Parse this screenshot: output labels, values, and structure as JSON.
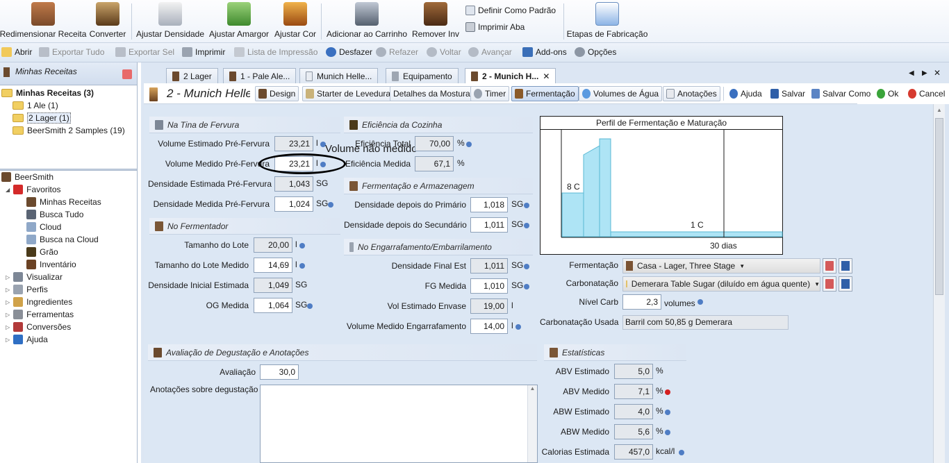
{
  "ribbon": {
    "buttons": [
      {
        "label": "Redimensionar Receita",
        "icon": "resize-recipe-icon",
        "color": "#8a5a3a"
      },
      {
        "label": "Converter",
        "icon": "convert-icon",
        "color": "#7a5a2a"
      },
      {
        "label": "Ajustar Densidade",
        "icon": "thermometer-icon",
        "color": "#b0b6c2"
      },
      {
        "label": "Ajustar Amargor",
        "icon": "hops-icon",
        "color": "#5aa042"
      },
      {
        "label": "Ajustar Cor",
        "icon": "beer-color-icon",
        "color": "#c8781e"
      },
      {
        "label": "Adicionar ao Carrinho",
        "icon": "cart-add-icon",
        "color": "#6a7686"
      },
      {
        "label": "Remover Inv",
        "icon": "inventory-remove-icon",
        "color": "#6b4224"
      },
      {
        "label": "Etapas de Fabricação",
        "icon": "brew-steps-icon",
        "color": "#5a8ed0"
      }
    ],
    "small": [
      {
        "label": "Definir Como Padrão",
        "icon": "set-default-icon"
      },
      {
        "label": "Imprimir Aba",
        "icon": "print-tab-icon"
      }
    ]
  },
  "quickbar": [
    {
      "label": "Abrir",
      "icon": "open-folder-icon",
      "enabled": true
    },
    {
      "label": "Exportar Tudo",
      "icon": "export-all-icon",
      "enabled": false
    },
    {
      "label": "Exportar Sel",
      "icon": "export-selected-icon",
      "enabled": false
    },
    {
      "label": "Imprimir",
      "icon": "print-icon",
      "enabled": true
    },
    {
      "label": "Lista de Impressão",
      "icon": "print-list-icon",
      "enabled": false
    },
    {
      "label": "Desfazer",
      "icon": "undo-icon",
      "enabled": true
    },
    {
      "label": "Refazer",
      "icon": "redo-icon",
      "enabled": false
    },
    {
      "label": "Voltar",
      "icon": "back-icon",
      "enabled": false
    },
    {
      "label": "Avançar",
      "icon": "forward-icon",
      "enabled": false
    },
    {
      "label": "Add-ons",
      "icon": "addons-icon",
      "enabled": true
    },
    {
      "label": "Opções",
      "icon": "options-gear-icon",
      "enabled": true
    }
  ],
  "recipes_panel": {
    "title": "Minhas Receitas",
    "tree": [
      {
        "label": "Minhas Receitas (3)",
        "level": 0,
        "bold": true
      },
      {
        "label": "1 Ale (1)",
        "level": 1
      },
      {
        "label": "2 Lager (1)",
        "level": 1,
        "selected": true
      },
      {
        "label": "BeerSmith 2 Samples (19)",
        "level": 1
      }
    ]
  },
  "nav_tree": [
    {
      "label": "BeerSmith",
      "level": 0,
      "icon": "beersmith-icon"
    },
    {
      "label": "Favoritos",
      "level": 1,
      "icon": "heart-icon"
    },
    {
      "label": "Minhas Receitas",
      "level": 2,
      "icon": "recipe-glass-icon"
    },
    {
      "label": "Busca Tudo",
      "level": 2,
      "icon": "search-all-icon"
    },
    {
      "label": "Cloud",
      "level": 2,
      "icon": "cloud-icon"
    },
    {
      "label": "Busca na Cloud",
      "level": 2,
      "icon": "cloud-search-icon"
    },
    {
      "label": "Grão",
      "level": 2,
      "icon": "grain-icon"
    },
    {
      "label": "Inventário",
      "level": 2,
      "icon": "inventory-icon"
    },
    {
      "label": "Visualizar",
      "level": 1,
      "icon": "view-icon"
    },
    {
      "label": "Perfis",
      "level": 1,
      "icon": "profiles-icon"
    },
    {
      "label": "Ingredientes",
      "level": 1,
      "icon": "ingredients-icon"
    },
    {
      "label": "Ferramentas",
      "level": 1,
      "icon": "tools-icon"
    },
    {
      "label": "Conversões",
      "level": 1,
      "icon": "conversions-icon"
    },
    {
      "label": "Ajuda",
      "level": 1,
      "icon": "help-icon"
    }
  ],
  "tabs": [
    {
      "label": "2 Lager"
    },
    {
      "label": "1 - Pale Ale..."
    },
    {
      "label": "Munich Helle..."
    },
    {
      "label": "Equipamento"
    },
    {
      "label": "2 - Munich H...",
      "active": true
    }
  ],
  "recipe_title": "2 - Munich Helle",
  "toolbar": [
    {
      "label": "Design",
      "icon": "design-icon"
    },
    {
      "label": "Starter de Levedura",
      "icon": "yeast-starter-icon"
    },
    {
      "label": "Detalhes da Mostura",
      "icon": "mash-icon"
    },
    {
      "label": "Timer",
      "icon": "timer-icon"
    },
    {
      "label": "Fermentação",
      "icon": "fermentation-icon",
      "active": true
    },
    {
      "label": "Volumes de Água",
      "icon": "water-icon"
    },
    {
      "label": "Anotações",
      "icon": "notes-icon"
    },
    {
      "label": "Ajuda",
      "icon": "help-icon",
      "flat": true
    },
    {
      "label": "Salvar",
      "icon": "save-icon",
      "flat": true
    },
    {
      "label": "Salvar Como",
      "icon": "save-as-icon",
      "flat": true
    },
    {
      "label": "Ok",
      "icon": "ok-icon",
      "flat": true
    },
    {
      "label": "Cancel",
      "icon": "cancel-icon",
      "flat": true
    }
  ],
  "boil": {
    "title": "Na Tina de Fervura",
    "est_vol": {
      "label": "Volume Estimado Pré-Fervura",
      "value": "23,21",
      "unit": "l"
    },
    "meas_vol": {
      "label": "Volume Medido Pré-Fervura",
      "value": "23,21",
      "unit": "l"
    },
    "est_grav": {
      "label": "Densidade Estimada Pré-Fervura",
      "value": "1,043",
      "unit": "SG"
    },
    "meas_grav": {
      "label": "Densidade Medida Pré-Fervura",
      "value": "1,024",
      "unit": "SG"
    }
  },
  "annotation_text": "Volume não medido",
  "efficiency": {
    "title": "Eficiência da Cozinha",
    "total": {
      "label": "Eficiência Total",
      "value": "70,00",
      "unit": "%"
    },
    "measured": {
      "label": "Eficiência Medida",
      "value": "67,1",
      "unit": "%"
    }
  },
  "fermenter": {
    "title": "No Fermentador",
    "batch": {
      "label": "Tamanho do Lote",
      "value": "20,00",
      "unit": "l"
    },
    "batch_meas": {
      "label": "Tamanho do Lote Medido",
      "value": "14,69",
      "unit": "l"
    },
    "og_est": {
      "label": "Densidade Inicial Estimada",
      "value": "1,049",
      "unit": "SG"
    },
    "og_meas": {
      "label": "OG Medida",
      "value": "1,064",
      "unit": "SG"
    }
  },
  "storage": {
    "title": "Fermentação e Armazenagem",
    "primary": {
      "label": "Densidade depois do Primário",
      "value": "1,018",
      "unit": "SG"
    },
    "secondary": {
      "label": "Densidade depois do Secundário",
      "value": "1,011",
      "unit": "SG"
    }
  },
  "bottling": {
    "title": "No Engarrafamento/Embarrilamento",
    "fg_est": {
      "label": "Densidade Final Est",
      "value": "1,011",
      "unit": "SG"
    },
    "fg_meas": {
      "label": "FG Medida",
      "value": "1,010",
      "unit": "SG"
    },
    "vol_est": {
      "label": "Vol Estimado Envase",
      "value": "19,00",
      "unit": "l"
    },
    "vol_meas": {
      "label": "Volume Medido Engarrafamento",
      "value": "14,00",
      "unit": "l"
    }
  },
  "profile_chart": {
    "title": "Perfil de Fermentação e Maturação",
    "start_label": "8 C",
    "end_label": "1 C",
    "days_label": "30 dias"
  },
  "fermentation": {
    "label": "Fermentação",
    "value": "Casa - Lager, Three Stage",
    "carb_label": "Carbonatação",
    "carb_value": "Demerara Table Sugar (diluído em água quente)",
    "level_label": "Nível Carb",
    "level_value": "2,3",
    "level_unit": "volumes",
    "used_label": "Carbonatação Usada",
    "used_value": "Barril com 50,85 g Demerara"
  },
  "tasting": {
    "title": "Avaliação de Degustação e Anotações",
    "rating_label": "Avaliação",
    "rating_value": "30,0",
    "notes_label": "Anotações sobre degustação",
    "notes_value": ""
  },
  "stats": {
    "title": "Estatísticas",
    "abv_est": {
      "label": "ABV Estimado",
      "value": "5,0",
      "unit": "%"
    },
    "abv_meas": {
      "label": "ABV Medido",
      "value": "7,1",
      "unit": "%"
    },
    "abw_est": {
      "label": "ABW Estimado",
      "value": "4,0",
      "unit": "%"
    },
    "abw_meas": {
      "label": "ABW Medido",
      "value": "5,6",
      "unit": "%"
    },
    "cal": {
      "label": "Calorias Estimada",
      "value": "457,0",
      "unit": "kcal/l"
    }
  }
}
